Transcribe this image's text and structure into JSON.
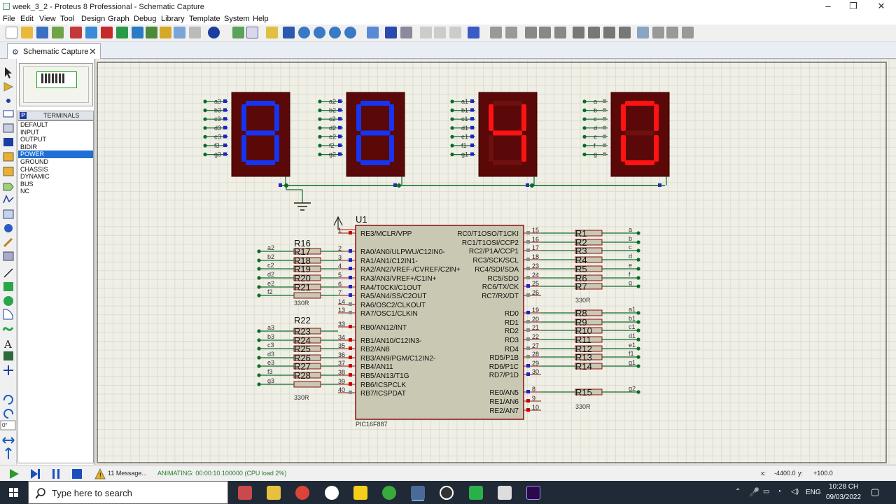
{
  "window": {
    "title": "week_3_2 - Proteus 8 Professional - Schematic Capture",
    "minimize": "–",
    "maximize": "❐",
    "close": "✕"
  },
  "menu": [
    "File",
    "Edit",
    "View",
    "Tool",
    "Design",
    "Graph",
    "Debug",
    "Library",
    "Template",
    "System",
    "Help"
  ],
  "tab": {
    "label": "Schematic Capture",
    "close": "✕"
  },
  "terminals": {
    "header": "TERMINALS",
    "header_badge": "P",
    "items": [
      "DEFAULT",
      "INPUT",
      "OUTPUT",
      "BIDIR",
      "POWER",
      "GROUND",
      "CHASSIS",
      "DYNAMIC",
      "BUS",
      "NC"
    ],
    "selected": "POWER"
  },
  "rotation_value": "0°",
  "colors": {
    "seg_on_blue": "#1535f2",
    "seg_on_red": "#ff1212",
    "display_bg": "#5a0808",
    "wire": "#0a6a2a",
    "pin_red": "#cc0000",
    "pin_blue": "#2020cc",
    "chip_fill": "#c9c8b2",
    "chip_border": "#8a0f12"
  },
  "schematic": {
    "displays": [
      {
        "digit": "8",
        "color": "blue",
        "pins": [
          "a3",
          "b3",
          "c3",
          "d3",
          "e3",
          "f3",
          "g3"
        ]
      },
      {
        "digit": "8",
        "color": "blue",
        "pins": [
          "a2",
          "b2",
          "c2",
          "d2",
          "e2",
          "f2",
          "g2"
        ]
      },
      {
        "digit": "4",
        "color": "red",
        "pins": [
          "a1",
          "b1",
          "c1",
          "d1",
          "e1",
          "f1",
          "g1"
        ]
      },
      {
        "digit": "0",
        "color": "red",
        "pins": [
          "a",
          "b",
          "c",
          "d",
          "e",
          "f",
          "g"
        ]
      }
    ],
    "chip": {
      "ref": "U1",
      "part": "PIC16F887",
      "left_pins": [
        {
          "num": "1",
          "name": "RE3/MCLR/VPP"
        },
        {
          "num": "2",
          "name": "RA0/AN0/ULPWU/C12IN0-"
        },
        {
          "num": "3",
          "name": "RA1/AN1/C12IN1-"
        },
        {
          "num": "4",
          "name": "RA2/AN2/VREF-/CVREF/C2IN+"
        },
        {
          "num": "5",
          "name": "RA3/AN3/VREF+/C1IN+"
        },
        {
          "num": "6",
          "name": "RA4/T0CKI/C1OUT"
        },
        {
          "num": "7",
          "name": "RA5/AN4/SS/C2OUT"
        },
        {
          "num": "14",
          "name": "RA6/OSC2/CLKOUT"
        },
        {
          "num": "13",
          "name": "RA7/OSC1/CLKIN"
        },
        {
          "num": "33",
          "name": "RB0/AN12/INT"
        },
        {
          "num": "34",
          "name": "RB1/AN10/C12IN3-"
        },
        {
          "num": "35",
          "name": "RB2/AN8"
        },
        {
          "num": "36",
          "name": "RB3/AN9/PGM/C12IN2-"
        },
        {
          "num": "37",
          "name": "RB4/AN11"
        },
        {
          "num": "38",
          "name": "RB5/AN13/T1G"
        },
        {
          "num": "39",
          "name": "RB6/ICSPCLK"
        },
        {
          "num": "40",
          "name": "RB7/ICSPDAT"
        }
      ],
      "right_pins": [
        {
          "num": "15",
          "name": "RC0/T1OSO/T1CKI"
        },
        {
          "num": "16",
          "name": "RC1/T1OSI/CCP2"
        },
        {
          "num": "17",
          "name": "RC2/P1A/CCP1"
        },
        {
          "num": "18",
          "name": "RC3/SCK/SCL"
        },
        {
          "num": "23",
          "name": "RC4/SDI/SDA"
        },
        {
          "num": "24",
          "name": "RC5/SDO"
        },
        {
          "num": "25",
          "name": "RC6/TX/CK"
        },
        {
          "num": "26",
          "name": "RC7/RX/DT"
        },
        {
          "num": "19",
          "name": "RD0"
        },
        {
          "num": "20",
          "name": "RD1"
        },
        {
          "num": "21",
          "name": "RD2"
        },
        {
          "num": "22",
          "name": "RD3"
        },
        {
          "num": "27",
          "name": "RD4"
        },
        {
          "num": "28",
          "name": "RD5/P1B"
        },
        {
          "num": "29",
          "name": "RD6/P1C"
        },
        {
          "num": "30",
          "name": "RD7/P1D"
        },
        {
          "num": "8",
          "name": "RE0/AN5"
        },
        {
          "num": "9",
          "name": "RE1/AN6"
        },
        {
          "num": "10",
          "name": "RE2/AN7"
        }
      ]
    },
    "resistor_groups": [
      {
        "refs": [
          "R16",
          "R17",
          "R18",
          "R19",
          "R20",
          "R21"
        ],
        "nets": [
          "a2",
          "b2",
          "c2",
          "d2",
          "e2",
          "f2"
        ],
        "value": "330R"
      },
      {
        "refs": [
          "R22",
          "R23",
          "R24",
          "R25",
          "R26",
          "R27",
          "R28"
        ],
        "nets": [
          "a3",
          "b3",
          "c3",
          "d3",
          "e3",
          "f3",
          "g3"
        ],
        "value": "330R"
      },
      {
        "refs": [
          "R1",
          "R2",
          "R3",
          "R4",
          "R5",
          "R6",
          "R7"
        ],
        "nets": [
          "a",
          "b",
          "c",
          "d",
          "e",
          "f",
          "g"
        ],
        "value": "330R"
      },
      {
        "refs": [
          "R8",
          "R9",
          "R10",
          "R11",
          "R12",
          "R13",
          "R14"
        ],
        "nets": [
          "a1",
          "b1",
          "c1",
          "d1",
          "e1",
          "f1",
          "g1"
        ],
        "value": ""
      },
      {
        "refs": [
          "R15"
        ],
        "nets": [
          "g2"
        ],
        "value": "330R"
      }
    ]
  },
  "status": {
    "messages": "11 Message...",
    "animating": "ANIMATING: 00:00:10.100000 (CPU load 2%)",
    "x_label": "x:",
    "x_value": "-4400.0",
    "y_label": "y:",
    "y_value": "+100.0"
  },
  "taskbar": {
    "search_placeholder": "Type here to search",
    "lang": "ENG",
    "time": "10:28 CH",
    "date": "09/03/2022",
    "apps": [
      "app-icon",
      "file-explorer-icon",
      "chrome-icon",
      "zalo-icon",
      "sticky-notes-icon",
      "greenshot-icon",
      "proteus-icon",
      "obs-icon",
      "camtasia-icon",
      "keyboard-app-icon",
      "premiere-icon"
    ]
  }
}
